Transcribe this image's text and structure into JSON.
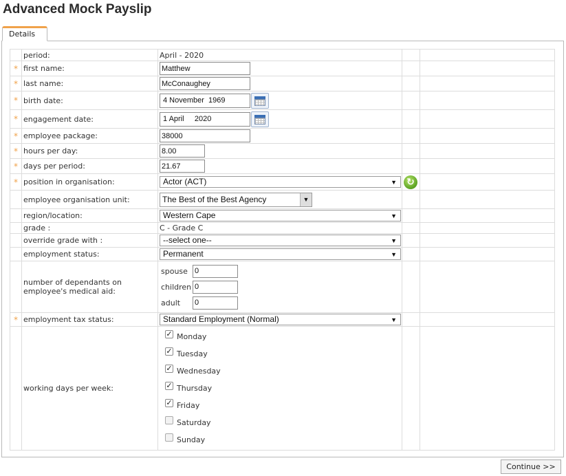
{
  "page": {
    "title": "Advanced Mock Payslip"
  },
  "tabs": [
    {
      "label": "Details"
    }
  ],
  "form": {
    "period": {
      "label": "period:",
      "value": "April - 2020"
    },
    "first_name": {
      "label": "first name:",
      "value": "Matthew"
    },
    "last_name": {
      "label": "last name:",
      "value": "McConaughey"
    },
    "birth_date": {
      "label": "birth date:",
      "value": "4 November  1969"
    },
    "engagement_date": {
      "label": "engagement date:",
      "value": "1 April     2020"
    },
    "employee_package": {
      "label": "employee package:",
      "value": "38000"
    },
    "hours_per_day": {
      "label": "hours per day:",
      "value": "8.00"
    },
    "days_per_period": {
      "label": "days per period:",
      "value": "21.67"
    },
    "position": {
      "label": "position in organisation:",
      "value": "Actor (ACT)"
    },
    "org_unit": {
      "label": "employee organisation unit:",
      "value": "The Best of the Best Agency"
    },
    "region": {
      "label": "region/location:",
      "value": "Western Cape"
    },
    "grade": {
      "label": "grade :",
      "value": "C - Grade C"
    },
    "override_grade": {
      "label": "override grade with :",
      "value": "--select one--"
    },
    "employment_status": {
      "label": "employment status:",
      "value": "Permanent"
    },
    "dependants": {
      "label": "number of dependants on employee's medical aid:",
      "spouse": {
        "label": "spouse",
        "value": "0"
      },
      "children": {
        "label": "children",
        "value": "0"
      },
      "adult": {
        "label": "adult",
        "value": "0"
      }
    },
    "tax_status": {
      "label": "employment tax status:",
      "value": "Standard Employment (Normal)"
    },
    "working_days": {
      "label": "working days per week:",
      "days": [
        {
          "label": "Monday",
          "checked": true
        },
        {
          "label": "Tuesday",
          "checked": true
        },
        {
          "label": "Wednesday",
          "checked": true
        },
        {
          "label": "Thursday",
          "checked": true
        },
        {
          "label": "Friday",
          "checked": true
        },
        {
          "label": "Saturday",
          "checked": false
        },
        {
          "label": "Sunday",
          "checked": false
        }
      ]
    },
    "required_marker": "*",
    "select_arrow": "▼"
  },
  "actions": {
    "continue_label": "Continue >>"
  },
  "colors": {
    "required": "#f0a24a",
    "tab_accent": "#f0a24a",
    "refresh": "#5aa222"
  }
}
